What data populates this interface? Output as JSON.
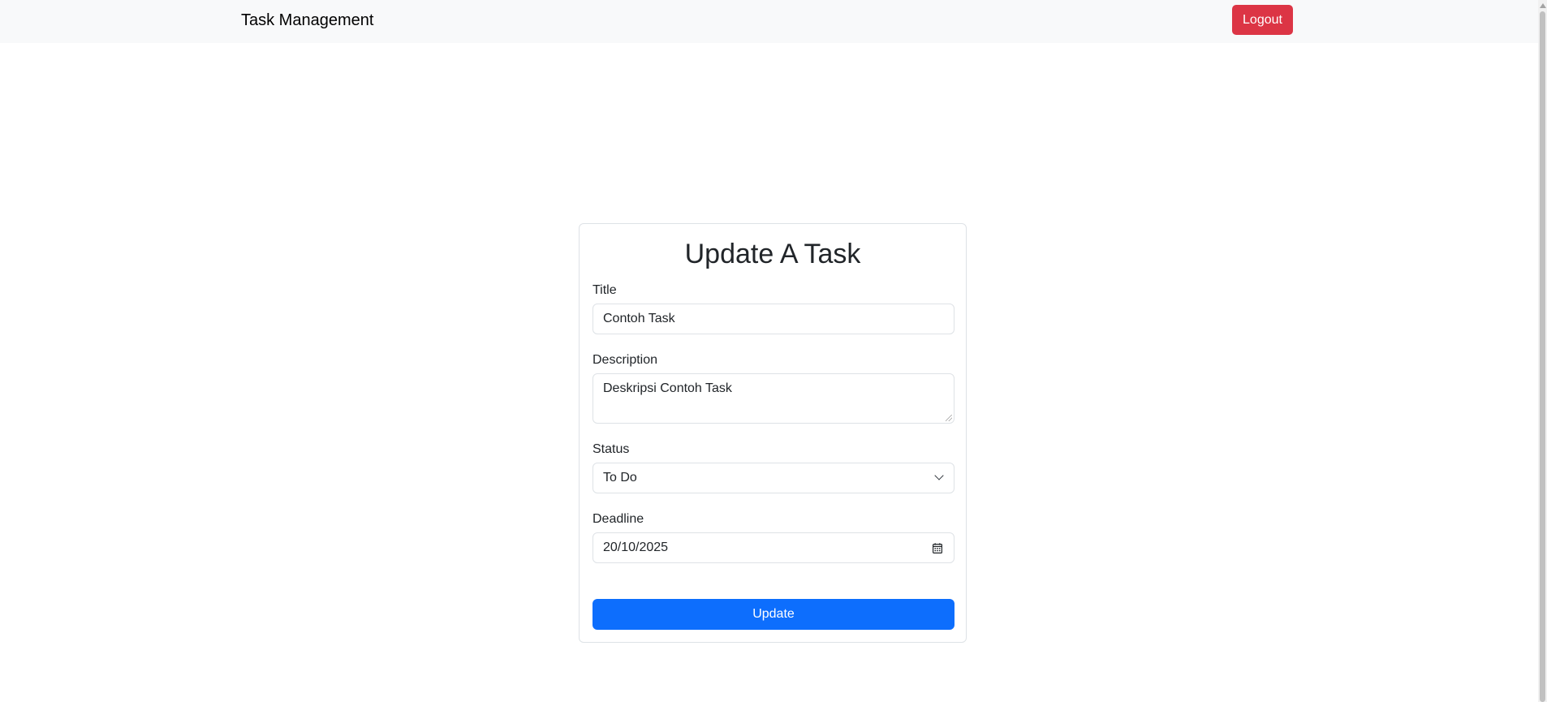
{
  "navbar": {
    "brand": "Task Management",
    "logout_label": "Logout"
  },
  "form": {
    "title": "Update A Task",
    "fields": {
      "title": {
        "label": "Title",
        "value": "Contoh Task"
      },
      "description": {
        "label": "Description",
        "value": "Deskripsi Contoh Task"
      },
      "status": {
        "label": "Status",
        "value": "To Do"
      },
      "deadline": {
        "label": "Deadline",
        "value": "20/10/2025"
      }
    },
    "submit_label": "Update"
  },
  "icons": {
    "status_select": "chevron-down-icon",
    "deadline_picker": "calendar-icon"
  },
  "colors": {
    "navbar_bg": "#f8f9fa",
    "logout": "#dc3545",
    "primary": "#0d6efd"
  }
}
